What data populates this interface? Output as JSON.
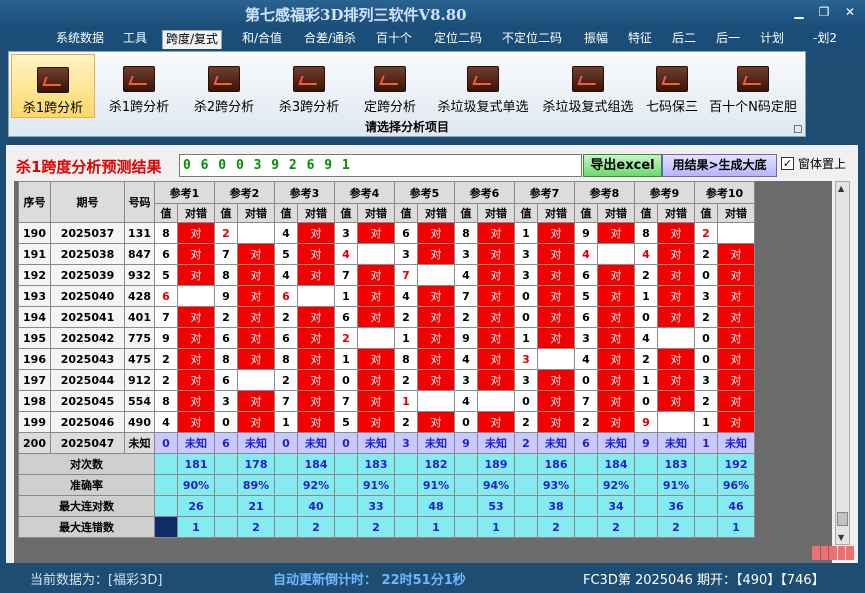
{
  "window": {
    "title": "第七感福彩3D排列三软件V8.80",
    "extra_label": "-划2"
  },
  "menu": [
    "系统数据",
    "工具",
    "跨度/复式",
    "和/合值",
    "合差/通杀",
    "百十个",
    "定位二码",
    "不定位二码",
    "振幅",
    "特征",
    "后二",
    "后一",
    "计划"
  ],
  "ribbon": {
    "buttons": [
      "杀1跨分析",
      "杀1跨分析",
      "杀2跨分析",
      "杀3跨分析",
      "定跨分析",
      "杀垃圾复式单选",
      "杀垃圾复式组选",
      "七码保三",
      "百十个N码定胆"
    ],
    "footer": "请选择分析项目"
  },
  "result": {
    "label": "杀1跨度分析预测结果",
    "value": "0 6 0 0 3 9 2 6 9 1",
    "excel_button": "导出excel",
    "gen_button": "用结果>生成大底",
    "ontop_label": "窗体置上",
    "ontop_checked": "✓"
  },
  "table": {
    "headers": {
      "seq": "序号",
      "period": "期号",
      "code": "号码"
    },
    "ref_labels": [
      "参考1",
      "参考2",
      "参考3",
      "参考4",
      "参考5",
      "参考6",
      "参考7",
      "参考8",
      "参考9",
      "参考10"
    ],
    "sub_value": "值",
    "sub_check": "对错",
    "hit_text": "对",
    "rows": [
      {
        "seq": "190",
        "period": "2025037",
        "code": "131",
        "vals": [
          "8",
          "2",
          "4",
          "3",
          "6",
          "8",
          "1",
          "9",
          "8",
          "2"
        ],
        "hit": [
          1,
          0,
          1,
          1,
          1,
          1,
          1,
          1,
          1,
          0
        ],
        "red": [
          0,
          1,
          0,
          0,
          0,
          0,
          0,
          0,
          0,
          1
        ]
      },
      {
        "seq": "191",
        "period": "2025038",
        "code": "847",
        "vals": [
          "6",
          "7",
          "5",
          "4",
          "3",
          "3",
          "3",
          "4",
          "4",
          "2"
        ],
        "hit": [
          1,
          1,
          1,
          0,
          1,
          1,
          1,
          0,
          1,
          1
        ],
        "red": [
          0,
          0,
          0,
          1,
          0,
          0,
          0,
          1,
          1,
          0
        ]
      },
      {
        "seq": "192",
        "period": "2025039",
        "code": "932",
        "vals": [
          "5",
          "8",
          "4",
          "7",
          "7",
          "4",
          "3",
          "6",
          "2",
          "0"
        ],
        "hit": [
          1,
          1,
          1,
          1,
          0,
          1,
          1,
          1,
          1,
          1
        ],
        "red": [
          0,
          0,
          0,
          0,
          1,
          0,
          0,
          0,
          0,
          0
        ]
      },
      {
        "seq": "193",
        "period": "2025040",
        "code": "428",
        "vals": [
          "6",
          "9",
          "6",
          "1",
          "4",
          "7",
          "0",
          "5",
          "1",
          "3"
        ],
        "hit": [
          0,
          1,
          0,
          1,
          1,
          1,
          1,
          1,
          1,
          1
        ],
        "red": [
          1,
          0,
          1,
          0,
          0,
          0,
          0,
          0,
          0,
          0
        ]
      },
      {
        "seq": "194",
        "period": "2025041",
        "code": "401",
        "vals": [
          "7",
          "2",
          "2",
          "6",
          "2",
          "2",
          "0",
          "6",
          "0",
          "2"
        ],
        "hit": [
          1,
          1,
          1,
          1,
          1,
          1,
          1,
          1,
          1,
          1
        ],
        "red": [
          0,
          0,
          0,
          0,
          0,
          0,
          0,
          0,
          0,
          0
        ]
      },
      {
        "seq": "195",
        "period": "2025042",
        "code": "775",
        "vals": [
          "9",
          "6",
          "6",
          "2",
          "1",
          "9",
          "1",
          "3",
          "4",
          "0"
        ],
        "hit": [
          1,
          1,
          1,
          0,
          1,
          1,
          1,
          1,
          0,
          1
        ],
        "red": [
          0,
          0,
          0,
          1,
          0,
          0,
          0,
          0,
          0,
          0
        ]
      },
      {
        "seq": "196",
        "period": "2025043",
        "code": "475",
        "vals": [
          "2",
          "8",
          "8",
          "1",
          "8",
          "4",
          "3",
          "4",
          "2",
          "0"
        ],
        "hit": [
          1,
          1,
          1,
          1,
          1,
          1,
          0,
          1,
          1,
          1
        ],
        "red": [
          0,
          0,
          0,
          0,
          0,
          0,
          1,
          0,
          0,
          0
        ]
      },
      {
        "seq": "197",
        "period": "2025044",
        "code": "912",
        "vals": [
          "2",
          "6",
          "2",
          "0",
          "2",
          "3",
          "3",
          "0",
          "1",
          "3"
        ],
        "hit": [
          1,
          0,
          1,
          1,
          1,
          1,
          1,
          1,
          1,
          1
        ],
        "red": [
          0,
          0,
          0,
          0,
          0,
          0,
          0,
          0,
          0,
          0
        ]
      },
      {
        "seq": "198",
        "period": "2025045",
        "code": "554",
        "vals": [
          "8",
          "3",
          "7",
          "7",
          "1",
          "4",
          "0",
          "7",
          "0",
          "2"
        ],
        "hit": [
          1,
          1,
          1,
          1,
          0,
          0,
          1,
          1,
          1,
          1
        ],
        "red": [
          0,
          0,
          0,
          0,
          1,
          0,
          0,
          0,
          0,
          0
        ]
      },
      {
        "seq": "199",
        "period": "2025046",
        "code": "490",
        "vals": [
          "4",
          "0",
          "1",
          "5",
          "2",
          "0",
          "2",
          "2",
          "9",
          "1"
        ],
        "hit": [
          1,
          1,
          1,
          1,
          1,
          1,
          1,
          1,
          0,
          1
        ],
        "red": [
          0,
          0,
          0,
          0,
          0,
          0,
          0,
          0,
          1,
          0
        ]
      }
    ],
    "unknown_row": {
      "seq": "200",
      "period": "2025047",
      "code": "未知",
      "vals": [
        "0",
        "6",
        "0",
        "0",
        "3",
        "9",
        "2",
        "6",
        "9",
        "1"
      ],
      "check": "未知"
    },
    "stats": [
      {
        "label": "对次数",
        "values": [
          "181",
          "178",
          "184",
          "183",
          "182",
          "189",
          "186",
          "184",
          "183",
          "192"
        ]
      },
      {
        "label": "准确率",
        "values": [
          "90%",
          "89%",
          "92%",
          "91%",
          "91%",
          "94%",
          "93%",
          "92%",
          "91%",
          "96%"
        ]
      },
      {
        "label": "最大连对数",
        "values": [
          "26",
          "21",
          "40",
          "33",
          "48",
          "53",
          "38",
          "34",
          "36",
          "46"
        ]
      },
      {
        "label": "最大连错数",
        "values": [
          "1",
          "2",
          "2",
          "2",
          "1",
          "1",
          "2",
          "2",
          "2",
          "1"
        ]
      }
    ]
  },
  "status": {
    "current": "当前数据为：[福彩3D]",
    "countdown": "自动更新倒计时：   22时51分1秒",
    "latest": "FC3D第 2025046 期开：【490】【746】"
  }
}
